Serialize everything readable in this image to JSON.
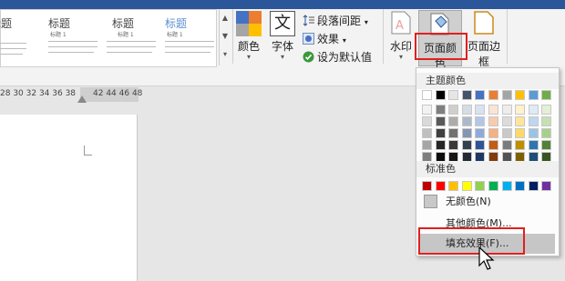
{
  "style_gallery": [
    {
      "title": "标题",
      "subtitle": ""
    },
    {
      "title": "标题",
      "subtitle": "标题 1"
    },
    {
      "title": "标题",
      "subtitle": "标题 1"
    },
    {
      "title": "标题",
      "subtitle": "标题 1"
    }
  ],
  "ribbon": {
    "colors_label": "颜色",
    "fonts_label": "字体",
    "fonts_glyph": "文",
    "paragraph_spacing_label": "段落间距",
    "effects_label": "效果",
    "set_default_label": "设为默认值",
    "watermark_label": "水印",
    "page_color_label": "页面颜色",
    "page_borders_label": "页面边框"
  },
  "ruler": {
    "ticks_left": "28 30 32 34 36 38",
    "ticks_right": "42 44 46 48"
  },
  "page_color_menu": {
    "theme_colors_header": "主题颜色",
    "standard_colors_header": "标准色",
    "no_color_label": "无颜色(N)",
    "more_colors_label": "其他颜色(M)...",
    "fill_effects_label": "填充效果(F)...",
    "theme_top": [
      "#ffffff",
      "#000000",
      "#e7e6e6",
      "#44546a",
      "#4472c4",
      "#ed7d31",
      "#a5a5a5",
      "#ffc000",
      "#5b9bd5",
      "#70ad47"
    ],
    "theme_shades": [
      [
        "#f2f2f2",
        "#7f7f7f",
        "#d0cece",
        "#d6dce4",
        "#d9e2f3",
        "#fbe4d5",
        "#ededed",
        "#fff2cc",
        "#deebf6",
        "#e2efd9"
      ],
      [
        "#d9d9d9",
        "#595959",
        "#aeabab",
        "#adb9ca",
        "#b4c6e7",
        "#f7cbac",
        "#dbdbdb",
        "#fee599",
        "#bdd7ee",
        "#c5e0b3"
      ],
      [
        "#bfbfbf",
        "#3f3f3f",
        "#757070",
        "#8496b0",
        "#8eaadb",
        "#f4b183",
        "#c9c9c9",
        "#ffd965",
        "#9cc3e5",
        "#a8d08d"
      ],
      [
        "#a5a5a5",
        "#262626",
        "#3a3838",
        "#323f4f",
        "#2f5496",
        "#c55a11",
        "#7b7b7b",
        "#bf8f00",
        "#2e75b5",
        "#538135"
      ],
      [
        "#7f7f7f",
        "#0c0c0c",
        "#171616",
        "#222a35",
        "#1f3864",
        "#833c0b",
        "#525252",
        "#7f6000",
        "#1e4e79",
        "#375623"
      ]
    ],
    "standard": [
      "#c00000",
      "#ff0000",
      "#ffc000",
      "#ffff00",
      "#92d050",
      "#00b050",
      "#00b0f0",
      "#0070c0",
      "#002060",
      "#7030a0"
    ]
  }
}
